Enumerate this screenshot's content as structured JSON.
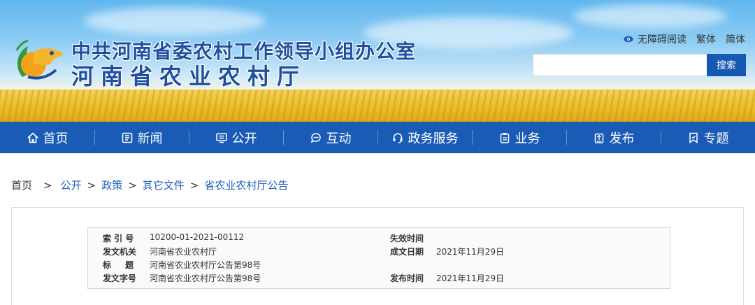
{
  "header": {
    "title_line1": "中共河南省委农村工作领导小组办公室",
    "title_line2": "河南省农业农村厅",
    "top_links": {
      "accessibility": "无障碍阅读",
      "traditional": "繁体",
      "simplified": "简体"
    },
    "search": {
      "button": "搜索",
      "value": ""
    }
  },
  "nav": {
    "items": [
      {
        "label": "首页",
        "icon": "home-icon"
      },
      {
        "label": "新闻",
        "icon": "news-icon"
      },
      {
        "label": "公开",
        "icon": "public-icon"
      },
      {
        "label": "互动",
        "icon": "chat-icon"
      },
      {
        "label": "政务服务",
        "icon": "headset-icon"
      },
      {
        "label": "业务",
        "icon": "clipboard-icon"
      },
      {
        "label": "发布",
        "icon": "publish-icon"
      },
      {
        "label": "专题",
        "icon": "bookmark-icon"
      }
    ]
  },
  "breadcrumb": {
    "home": "首页",
    "sep1": ">",
    "items": [
      "公开",
      "政策",
      "其它文件",
      "省农业农村厅公告"
    ],
    "sep": ">"
  },
  "meta": {
    "index_label": "索 引 号",
    "index_value": "10200-01-2021-00112",
    "expire_label": "失效时间",
    "expire_value": "",
    "issuer_label": "发文机关",
    "issuer_value": "河南省农业农村厅",
    "created_label": "成文日期",
    "created_value": "2021年11月29日",
    "title_label_a": "标",
    "title_label_b": "题",
    "title_value": "河南省农业农村厅公告第98号",
    "docno_label": "发文字号",
    "docno_value": "河南省农业农村厅公告第98号",
    "published_label": "发布时间",
    "published_value": "2021年11月29日"
  },
  "colors": {
    "brand_blue": "#1a5bb5",
    "link_blue": "#1f5fbf",
    "title_blue": "#1f4f9e"
  }
}
